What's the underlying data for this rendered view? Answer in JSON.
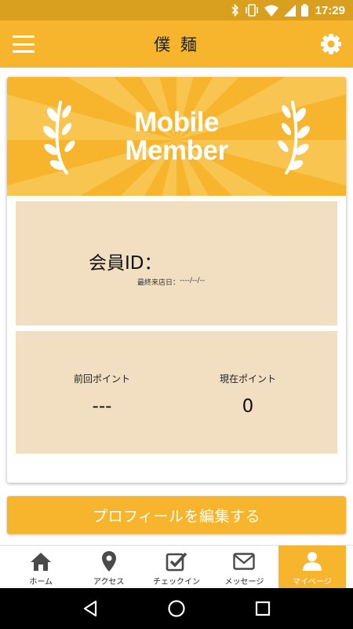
{
  "status_bar": {
    "time": "17:29",
    "icons": [
      "bluetooth-icon",
      "vibrate-icon",
      "wifi-icon",
      "signal-icon",
      "battery-icon"
    ]
  },
  "app_bar": {
    "title": "僕 麺",
    "menu_icon": "hamburger-menu-icon",
    "settings_icon": "gear-icon"
  },
  "banner": {
    "line1": "Mobile",
    "line2": "Member",
    "decoration": "laurel-icon"
  },
  "member": {
    "id_label": "会員ID：",
    "id_value": "",
    "last_visit_label": "最終来店日：",
    "last_visit_value": "----/--/--"
  },
  "points": {
    "previous_label": "前回ポイント",
    "previous_value": "---",
    "current_label": "現在ポイント",
    "current_value": "0"
  },
  "edit_button": {
    "label": "プロフィールを編集する"
  },
  "tabs": [
    {
      "label": "ホーム",
      "icon": "home-icon",
      "active": false
    },
    {
      "label": "アクセス",
      "icon": "map-pin-icon",
      "active": false
    },
    {
      "label": "チェックイン",
      "icon": "checkbox-icon",
      "active": false
    },
    {
      "label": "メッセージ",
      "icon": "envelope-icon",
      "active": false
    },
    {
      "label": "マイページ",
      "icon": "user-icon",
      "active": true
    }
  ],
  "nav_bar": {
    "icons": [
      "back-icon",
      "home-circle-icon",
      "recents-icon"
    ]
  },
  "colors": {
    "accent": "#f6b52d",
    "status_bar": "#d99f1e",
    "panel": "#f2dfc2"
  }
}
